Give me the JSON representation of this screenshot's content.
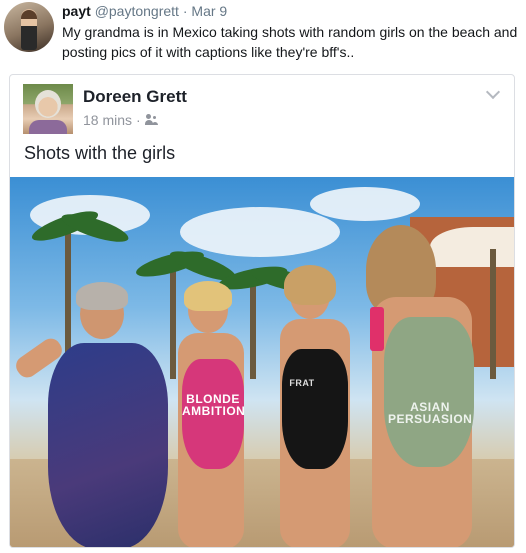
{
  "tweet": {
    "display_name": "payt",
    "handle": "@paytongrett",
    "separator": "·",
    "date": "Mar 9",
    "text": "My grandma is in Mexico taking shots with random girls on the beach and posting pics of it with captions like they're bff's.."
  },
  "fb_post": {
    "author": "Doreen Grett",
    "time": "18 mins",
    "separator": "·",
    "audience_icon": "friends-icon",
    "menu_icon": "chevron-down-icon",
    "caption": "Shots with the girls",
    "photo": {
      "swimsuit_texts": [
        "BLONDE AMBITION",
        "FRAT",
        "ASIAN PERSUASION"
      ]
    }
  },
  "colors": {
    "tweet_text": "#14171a",
    "tweet_muted": "#657786",
    "fb_name": "#1d2129",
    "fb_muted": "#90949c",
    "card_border": "#dcdee3"
  }
}
